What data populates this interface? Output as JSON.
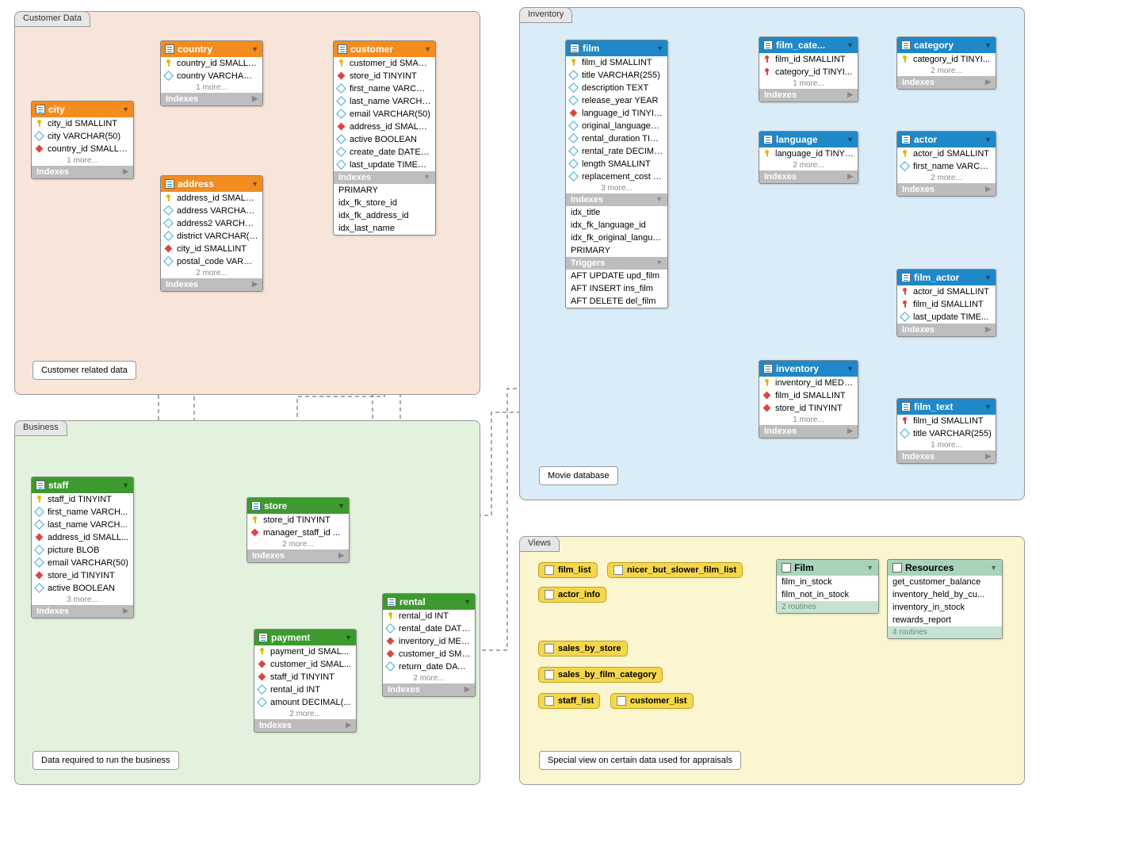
{
  "groups": {
    "customer": {
      "label": "Customer Data",
      "note": "Customer related data"
    },
    "business": {
      "label": "Business",
      "note": "Data required to run the business"
    },
    "inventory": {
      "label": "Inventory",
      "note": "Movie database"
    },
    "views": {
      "label": "Views",
      "note": "Special view on certain data used for appraisals"
    }
  },
  "tables": {
    "country": {
      "name": "country",
      "columns": [
        {
          "icon": "pk",
          "label": "country_id SMALLINT"
        },
        {
          "icon": "col",
          "label": "country VARCHAR(50)"
        }
      ],
      "more": "1 more...",
      "indexes_label": "Indexes"
    },
    "city": {
      "name": "city",
      "columns": [
        {
          "icon": "pk",
          "label": "city_id SMALLINT"
        },
        {
          "icon": "col",
          "label": "city VARCHAR(50)"
        },
        {
          "icon": "fk",
          "label": "country_id SMALLINT"
        }
      ],
      "more": "1 more...",
      "indexes_label": "Indexes"
    },
    "address": {
      "name": "address",
      "columns": [
        {
          "icon": "pk",
          "label": "address_id SMALLINT"
        },
        {
          "icon": "col",
          "label": "address VARCHAR(50)"
        },
        {
          "icon": "col",
          "label": "address2 VARCHAR(..."
        },
        {
          "icon": "col",
          "label": "district VARCHAR(20)"
        },
        {
          "icon": "fk",
          "label": "city_id SMALLINT"
        },
        {
          "icon": "col",
          "label": "postal_code VARCH..."
        }
      ],
      "more": "2 more...",
      "indexes_label": "Indexes"
    },
    "customer": {
      "name": "customer",
      "columns": [
        {
          "icon": "pk",
          "label": "customer_id SMALLI..."
        },
        {
          "icon": "fk",
          "label": "store_id TINYINT"
        },
        {
          "icon": "col",
          "label": "first_name VARCHA..."
        },
        {
          "icon": "col",
          "label": "last_name VARCHAR..."
        },
        {
          "icon": "col",
          "label": "email VARCHAR(50)"
        },
        {
          "icon": "fk",
          "label": "address_id SMALLINT"
        },
        {
          "icon": "col",
          "label": "active BOOLEAN"
        },
        {
          "icon": "col",
          "label": "create_date DATETI..."
        },
        {
          "icon": "col",
          "label": "last_update TIMEST..."
        }
      ],
      "indexes_label": "Indexes",
      "indexes": [
        "PRIMARY",
        "idx_fk_store_id",
        "idx_fk_address_id",
        "idx_last_name"
      ]
    },
    "film": {
      "name": "film",
      "columns": [
        {
          "icon": "pk",
          "label": "film_id SMALLINT"
        },
        {
          "icon": "col",
          "label": "title VARCHAR(255)"
        },
        {
          "icon": "col",
          "label": "description TEXT"
        },
        {
          "icon": "col",
          "label": "release_year YEAR"
        },
        {
          "icon": "fk",
          "label": "language_id TINYINT"
        },
        {
          "icon": "col",
          "label": "original_language_id..."
        },
        {
          "icon": "col",
          "label": "rental_duration TIN..."
        },
        {
          "icon": "col",
          "label": "rental_rate DECIMA..."
        },
        {
          "icon": "col",
          "label": "length SMALLINT"
        },
        {
          "icon": "col",
          "label": "replacement_cost D..."
        }
      ],
      "more": "3 more...",
      "indexes_label": "Indexes",
      "indexes": [
        "idx_title",
        "idx_fk_language_id",
        "idx_fk_original_langua...",
        "PRIMARY"
      ],
      "triggers_label": "Triggers",
      "triggers": [
        "AFT UPDATE upd_film",
        "AFT INSERT ins_film",
        "AFT DELETE del_film"
      ]
    },
    "film_category": {
      "name": "film_cate...",
      "columns": [
        {
          "icon": "pk-red",
          "label": "film_id SMALLINT"
        },
        {
          "icon": "pk-red",
          "label": "category_id TINYI..."
        }
      ],
      "more": "1 more...",
      "indexes_label": "Indexes"
    },
    "category": {
      "name": "category",
      "columns": [
        {
          "icon": "pk",
          "label": "category_id TINYI..."
        }
      ],
      "more": "2 more...",
      "indexes_label": "Indexes"
    },
    "language": {
      "name": "language",
      "columns": [
        {
          "icon": "pk",
          "label": "language_id TINYI..."
        }
      ],
      "more": "2 more...",
      "indexes_label": "Indexes"
    },
    "actor": {
      "name": "actor",
      "columns": [
        {
          "icon": "pk",
          "label": "actor_id SMALLINT"
        },
        {
          "icon": "col",
          "label": "first_name VARCH..."
        }
      ],
      "more": "2 more...",
      "indexes_label": "Indexes"
    },
    "film_actor": {
      "name": "film_actor",
      "columns": [
        {
          "icon": "pk-red",
          "label": "actor_id SMALLINT"
        },
        {
          "icon": "pk-red",
          "label": "film_id SMALLINT"
        },
        {
          "icon": "col",
          "label": "last_update TIME..."
        }
      ],
      "indexes_label": "Indexes"
    },
    "inventory": {
      "name": "inventory",
      "columns": [
        {
          "icon": "pk",
          "label": "inventory_id MEDI..."
        },
        {
          "icon": "fk",
          "label": "film_id SMALLINT"
        },
        {
          "icon": "fk",
          "label": "store_id TINYINT"
        }
      ],
      "more": "1 more...",
      "indexes_label": "Indexes"
    },
    "film_text": {
      "name": "film_text",
      "columns": [
        {
          "icon": "pk-red",
          "label": "film_id SMALLINT"
        },
        {
          "icon": "col",
          "label": "title VARCHAR(255)"
        }
      ],
      "more": "1 more...",
      "indexes_label": "Indexes"
    },
    "staff": {
      "name": "staff",
      "columns": [
        {
          "icon": "pk",
          "label": "staff_id TINYINT"
        },
        {
          "icon": "col",
          "label": "first_name VARCH..."
        },
        {
          "icon": "col",
          "label": "last_name VARCH..."
        },
        {
          "icon": "fk",
          "label": "address_id SMALL..."
        },
        {
          "icon": "col",
          "label": "picture BLOB"
        },
        {
          "icon": "col",
          "label": "email VARCHAR(50)"
        },
        {
          "icon": "fk",
          "label": "store_id TINYINT"
        },
        {
          "icon": "col",
          "label": "active BOOLEAN"
        }
      ],
      "more": "3 more...",
      "indexes_label": "Indexes"
    },
    "store": {
      "name": "store",
      "columns": [
        {
          "icon": "pk",
          "label": "store_id TINYINT"
        },
        {
          "icon": "fk",
          "label": "manager_staff_id ..."
        }
      ],
      "more": "2 more...",
      "indexes_label": "Indexes"
    },
    "rental": {
      "name": "rental",
      "columns": [
        {
          "icon": "pk",
          "label": "rental_id INT"
        },
        {
          "icon": "col",
          "label": "rental_date DATE..."
        },
        {
          "icon": "fk",
          "label": "inventory_id MEDI..."
        },
        {
          "icon": "fk",
          "label": "customer_id SMAL..."
        },
        {
          "icon": "col",
          "label": "return_date DATE..."
        }
      ],
      "more": "2 more...",
      "indexes_label": "Indexes"
    },
    "payment": {
      "name": "payment",
      "columns": [
        {
          "icon": "pk",
          "label": "payment_id SMAL..."
        },
        {
          "icon": "fk",
          "label": "customer_id SMAL..."
        },
        {
          "icon": "fk",
          "label": "staff_id TINYINT"
        },
        {
          "icon": "col",
          "label": "rental_id INT"
        },
        {
          "icon": "col",
          "label": "amount DECIMAL(..."
        }
      ],
      "more": "2 more...",
      "indexes_label": "Indexes"
    }
  },
  "views": {
    "items": [
      "film_list",
      "nicer_but_slower_film_list",
      "actor_info",
      "sales_by_store",
      "sales_by_film_category",
      "staff_list",
      "customer_list"
    ],
    "film_box": {
      "name": "Film",
      "items": [
        "film_in_stock",
        "film_not_in_stock"
      ],
      "footer": "2 routines"
    },
    "resources_box": {
      "name": "Resources",
      "items": [
        "get_customer_balance",
        "inventory_held_by_cu...",
        "inventory_in_stock",
        "rewards_report"
      ],
      "footer": "4 routines"
    }
  }
}
